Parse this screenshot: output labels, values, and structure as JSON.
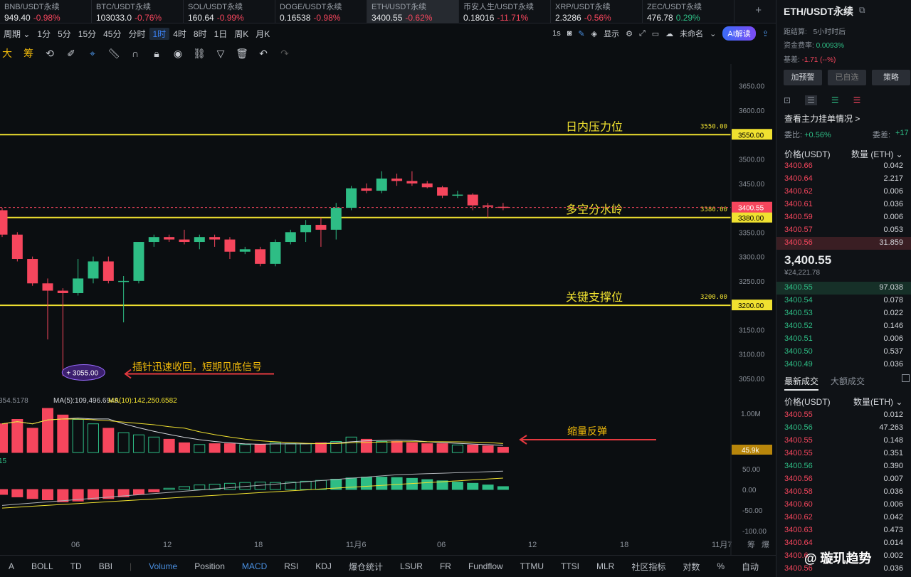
{
  "tickers": [
    {
      "name": "BNB/USDT永续",
      "price": "949.40",
      "change": "-0.98%",
      "dir": "dn"
    },
    {
      "name": "BTC/USDT永续",
      "price": "103033.0",
      "change": "-0.76%",
      "dir": "dn"
    },
    {
      "name": "SOL/USDT永续",
      "price": "160.64",
      "change": "-0.99%",
      "dir": "dn"
    },
    {
      "name": "DOGE/USDT永续",
      "price": "0.16538",
      "change": "-0.98%",
      "dir": "dn"
    },
    {
      "name": "ETH/USDT永续",
      "price": "3400.55",
      "change": "-0.62%",
      "dir": "dn"
    },
    {
      "name": "币安人生/USDT永续",
      "price": "0.18016",
      "change": "-11.71%",
      "dir": "dn"
    },
    {
      "name": "XRP/USDT永续",
      "price": "2.3286",
      "change": "-0.56%",
      "dir": "dn"
    },
    {
      "name": "ZEC/USDT永续",
      "price": "476.78",
      "change": "0.29%",
      "dir": "up"
    }
  ],
  "period_bar": {
    "items": [
      "周期 ⌄",
      "1分",
      "5分",
      "15分",
      "45分",
      "分时",
      "1时",
      "4时",
      "8时",
      "1日",
      "周K",
      "月K"
    ],
    "selected": "1时",
    "right": {
      "interval": "1s",
      "display": "显示",
      "unnamed": "未命名",
      "ai": "AI解读"
    }
  },
  "draw_toolbar": {
    "first": "大",
    "second": "筹"
  },
  "chart": {
    "price_ticks": [
      "3650.00",
      "3600.00",
      "3550.00",
      "3500.00",
      "3450.00",
      "3400.00",
      "3350.00",
      "3300.00",
      "3250.00",
      "3200.00",
      "3150.00",
      "3100.00",
      "3050.00"
    ],
    "lines": [
      {
        "price": 3550,
        "label": "日内压力位",
        "value": "3550.00",
        "tag": "3550.00"
      },
      {
        "price": 3380,
        "label": "多空分水岭",
        "value": "3380.00",
        "tag": "3380.00"
      },
      {
        "price": 3200,
        "label": "关键支撑位",
        "value": "3200.00",
        "tag": "3200.00"
      }
    ],
    "last_price_tag": "3400.55",
    "low_marker": "3055.00",
    "low_annotation": "插针迅速收回，短期见底信号",
    "volume_annotation": "缩量反弹",
    "volume_legend": {
      "prefix": "354.5178",
      "ma5": "MA(5):109,496.6948",
      "ma10": "MA(10):142,250.6582"
    },
    "volume_ticks": [
      "1.00M",
      "45.9k"
    ],
    "macd_prefix": "15",
    "macd_ticks": [
      "50.00",
      "0.00",
      "-50.00",
      "-100.00"
    ],
    "time_labels": [
      "06",
      "12",
      "18",
      "11月6",
      "06",
      "12",
      "18",
      "11月7"
    ],
    "axis_controls": [
      "筹",
      "爆"
    ],
    "up_color": "#2ebd85",
    "down_color": "#f6465d",
    "line_color": "#f0e130",
    "candles": [
      {
        "o": 3395,
        "h": 3400,
        "l": 3340,
        "c": 3345
      },
      {
        "o": 3345,
        "h": 3350,
        "l": 3290,
        "c": 3295
      },
      {
        "o": 3295,
        "h": 3300,
        "l": 3240,
        "c": 3245
      },
      {
        "o": 3245,
        "h": 3255,
        "l": 3130,
        "c": 3230
      },
      {
        "o": 3230,
        "h": 3235,
        "l": 3055,
        "c": 3225
      },
      {
        "o": 3225,
        "h": 3295,
        "l": 3220,
        "c": 3255
      },
      {
        "o": 3255,
        "h": 3300,
        "l": 3245,
        "c": 3290
      },
      {
        "o": 3290,
        "h": 3300,
        "l": 3245,
        "c": 3250
      },
      {
        "o": 3250,
        "h": 3260,
        "l": 3165,
        "c": 3250
      },
      {
        "o": 3250,
        "h": 3330,
        "l": 3245,
        "c": 3330
      },
      {
        "o": 3330,
        "h": 3345,
        "l": 3320,
        "c": 3340
      },
      {
        "o": 3340,
        "h": 3345,
        "l": 3330,
        "c": 3335
      },
      {
        "o": 3335,
        "h": 3355,
        "l": 3325,
        "c": 3330
      },
      {
        "o": 3330,
        "h": 3345,
        "l": 3315,
        "c": 3340
      },
      {
        "o": 3340,
        "h": 3345,
        "l": 3320,
        "c": 3335
      },
      {
        "o": 3335,
        "h": 3340,
        "l": 3295,
        "c": 3310
      },
      {
        "o": 3310,
        "h": 3320,
        "l": 3305,
        "c": 3315
      },
      {
        "o": 3315,
        "h": 3320,
        "l": 3280,
        "c": 3285
      },
      {
        "o": 3285,
        "h": 3335,
        "l": 3280,
        "c": 3330
      },
      {
        "o": 3330,
        "h": 3355,
        "l": 3325,
        "c": 3350
      },
      {
        "o": 3350,
        "h": 3375,
        "l": 3330,
        "c": 3365
      },
      {
        "o": 3365,
        "h": 3380,
        "l": 3320,
        "c": 3355
      },
      {
        "o": 3355,
        "h": 3410,
        "l": 3335,
        "c": 3400
      },
      {
        "o": 3400,
        "h": 3445,
        "l": 3395,
        "c": 3440
      },
      {
        "o": 3440,
        "h": 3450,
        "l": 3430,
        "c": 3435
      },
      {
        "o": 3435,
        "h": 3475,
        "l": 3430,
        "c": 3460
      },
      {
        "o": 3460,
        "h": 3470,
        "l": 3445,
        "c": 3455
      },
      {
        "o": 3455,
        "h": 3475,
        "l": 3445,
        "c": 3450
      },
      {
        "o": 3450,
        "h": 3455,
        "l": 3440,
        "c": 3442
      },
      {
        "o": 3442,
        "h": 3445,
        "l": 3420,
        "c": 3425
      },
      {
        "o": 3425,
        "h": 3435,
        "l": 3420,
        "c": 3427
      },
      {
        "o": 3427,
        "h": 3430,
        "l": 3395,
        "c": 3405
      },
      {
        "o": 3405,
        "h": 3410,
        "l": 3380,
        "c": 3402
      },
      {
        "o": 3402,
        "h": 3410,
        "l": 3395,
        "c": 3400
      }
    ],
    "volumes": [
      0.65,
      0.75,
      0.55,
      1.0,
      0.85,
      0.75,
      0.65,
      0.55,
      0.45,
      0.4,
      0.35,
      0.3,
      0.22,
      0.18,
      0.2,
      0.2,
      0.18,
      0.18,
      0.22,
      0.2,
      0.2,
      0.22,
      0.25,
      0.35,
      0.3,
      0.25,
      0.25,
      0.22,
      0.2,
      0.2,
      0.17,
      0.17,
      0.15,
      0.12
    ],
    "macd_hist": [
      -12,
      -18,
      -22,
      -25,
      -30,
      -28,
      -24,
      -22,
      -18,
      -12,
      -6,
      3,
      7,
      11,
      13,
      15,
      17,
      18,
      17,
      18,
      20,
      22,
      25,
      28,
      30,
      30,
      29,
      27,
      24,
      21,
      18,
      15,
      11,
      7
    ]
  },
  "panel": {
    "title": "ETH/USDT永续",
    "settle_label": "距结算:",
    "settle_value": "5小时时后",
    "funding_label": "资金费率:",
    "funding_value": "0.0093%",
    "basis_label": "基差:",
    "basis_value": "-1.71 (--%)",
    "buttons": [
      "加预警",
      "已自选",
      "策略"
    ],
    "depth_title": "查看主力挂单情况 >",
    "ratio_label": "委比:",
    "ratio_value": "+0.56%",
    "diff_label": "委差:",
    "diff_value": "+17",
    "price_hdr": "价格(USDT)",
    "qty_hdr": "数量 (ETH) ⌄",
    "asks": [
      [
        "3400.66",
        "0.042"
      ],
      [
        "3400.64",
        "2.217"
      ],
      [
        "3400.62",
        "0.006"
      ],
      [
        "3400.61",
        "0.036"
      ],
      [
        "3400.59",
        "0.006"
      ],
      [
        "3400.57",
        "0.053"
      ],
      [
        "3400.56",
        "31.859"
      ]
    ],
    "last_price": "3,400.55",
    "last_cny": "¥24,221.78",
    "bids": [
      [
        "3400.55",
        "97.038"
      ],
      [
        "3400.54",
        "0.078"
      ],
      [
        "3400.53",
        "0.022"
      ],
      [
        "3400.52",
        "0.146"
      ],
      [
        "3400.51",
        "0.006"
      ],
      [
        "3400.50",
        "0.537"
      ],
      [
        "3400.49",
        "0.036"
      ]
    ],
    "trades_tab1": "最新成交",
    "trades_tab2": "大额成交",
    "t_price_hdr": "价格(USDT)",
    "t_qty_hdr": "数量(ETH) ⌄",
    "trades": [
      [
        "3400.55",
        "0.012",
        "dn"
      ],
      [
        "3400.56",
        "47.263",
        "up"
      ],
      [
        "3400.55",
        "0.148",
        "dn"
      ],
      [
        "3400.55",
        "0.351",
        "dn"
      ],
      [
        "3400.56",
        "0.390",
        "up"
      ],
      [
        "3400.56",
        "0.007",
        "dn"
      ],
      [
        "3400.58",
        "0.036",
        "dn"
      ],
      [
        "3400.60",
        "0.006",
        "dn"
      ],
      [
        "3400.62",
        "0.042",
        "dn"
      ],
      [
        "3400.63",
        "0.473",
        "dn"
      ],
      [
        "3400.64",
        "0.014",
        "dn"
      ],
      [
        "3400.6",
        "0.002",
        "dn"
      ],
      [
        "3400.56",
        "0.036",
        "dn"
      ]
    ]
  },
  "indicator_bar": [
    "A",
    "BOLL",
    "TD",
    "BBI",
    "|",
    "Volume",
    "Position",
    "MACD",
    "RSI",
    "KDJ",
    "爆仓统计",
    "LSUR",
    "FR",
    "Fundflow",
    "TTMU",
    "TTSI",
    "MLR",
    "社区指标",
    "对数",
    "%",
    "自动"
  ],
  "indicator_selected": [
    "Volume",
    "MACD"
  ],
  "watermark": "@ 璇玑趋势"
}
